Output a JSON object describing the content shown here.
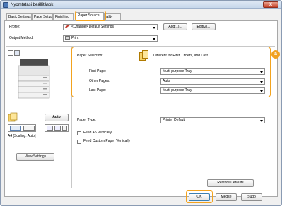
{
  "window": {
    "title": "Nyomtatási beállítások",
    "close_label": "X"
  },
  "tabs": [
    "Basic Settings",
    "Page Setup",
    "Finishing",
    "Paper Source",
    "Quality"
  ],
  "profile": {
    "label": "Profile:",
    "value": "<Change> Default Settings",
    "add_label": "Add(1)...",
    "edit_label": "Edit(2)..."
  },
  "output_method": {
    "label": "Output Method:",
    "value": "Print"
  },
  "paper_selection": {
    "label": "Paper Selection:",
    "value": "Different for First, Others, and Last"
  },
  "first_page": {
    "label": "First Page:",
    "value": "Multi-purpose Tray"
  },
  "other_pages": {
    "label": "Other Pages:",
    "value": "Auto"
  },
  "last_page": {
    "label": "Last Page:",
    "value": "Multi-purpose Tray"
  },
  "paper_type": {
    "label": "Paper Type:",
    "value": "Printer Default"
  },
  "feed_a5": {
    "label": "Feed A5 Vertically"
  },
  "feed_custom": {
    "label": "Feed Custom Paper Vertically"
  },
  "preview": {
    "auto_label": "Auto",
    "scaling": "A4 [Scaling: Auto]",
    "view_settings_label": "View Settings"
  },
  "callout": "a",
  "buttons": {
    "restore_defaults": "Restore Defaults",
    "ok": "OK",
    "cancel": "Mégse",
    "help": "Súgó"
  },
  "colors": {
    "highlight": "#f3a31e",
    "callout": "#f0a020"
  }
}
